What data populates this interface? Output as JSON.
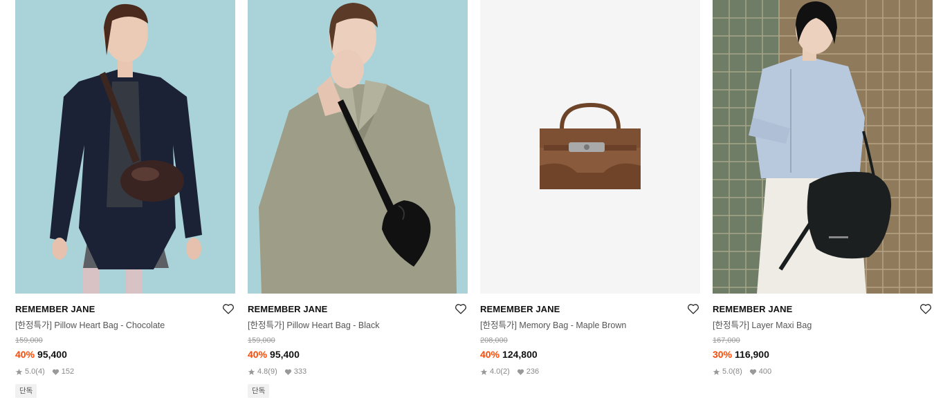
{
  "products": [
    {
      "brand": "REMEMBER JANE",
      "name": "[한정특가] Pillow Heart Bag - Chocolate",
      "original_price": "159,000",
      "discount": "40%",
      "sale_price": "95,400",
      "rating": "5.0",
      "review_count": "(4)",
      "likes": "152",
      "tag": "단독"
    },
    {
      "brand": "REMEMBER JANE",
      "name": "[한정특가] Pillow Heart Bag - Black",
      "original_price": "159,000",
      "discount": "40%",
      "sale_price": "95,400",
      "rating": "4.8",
      "review_count": "(9)",
      "likes": "333",
      "tag": "단독"
    },
    {
      "brand": "REMEMBER JANE",
      "name": "[한정특가] Memory Bag - Maple Brown",
      "original_price": "208,000",
      "discount": "40%",
      "sale_price": "124,800",
      "rating": "4.0",
      "review_count": "(2)",
      "likes": "236"
    },
    {
      "brand": "REMEMBER JANE",
      "name": "[한정특가] Layer Maxi Bag",
      "original_price": "167,000",
      "discount": "30%",
      "sale_price": "116,900",
      "rating": "5.0",
      "review_count": "(8)",
      "likes": "400"
    }
  ],
  "colors": {
    "discount": "#ff4800",
    "thumb_bg_1": "#a9d3d8",
    "thumb_bg_2": "#a9d3d8",
    "thumb_bg_3": "#f5f5f5",
    "thumb_bg_4": "#8f7a5c"
  },
  "icons": {
    "like": "heart-outline-icon",
    "rating": "star-icon",
    "likes_count": "heart-filled-icon"
  }
}
